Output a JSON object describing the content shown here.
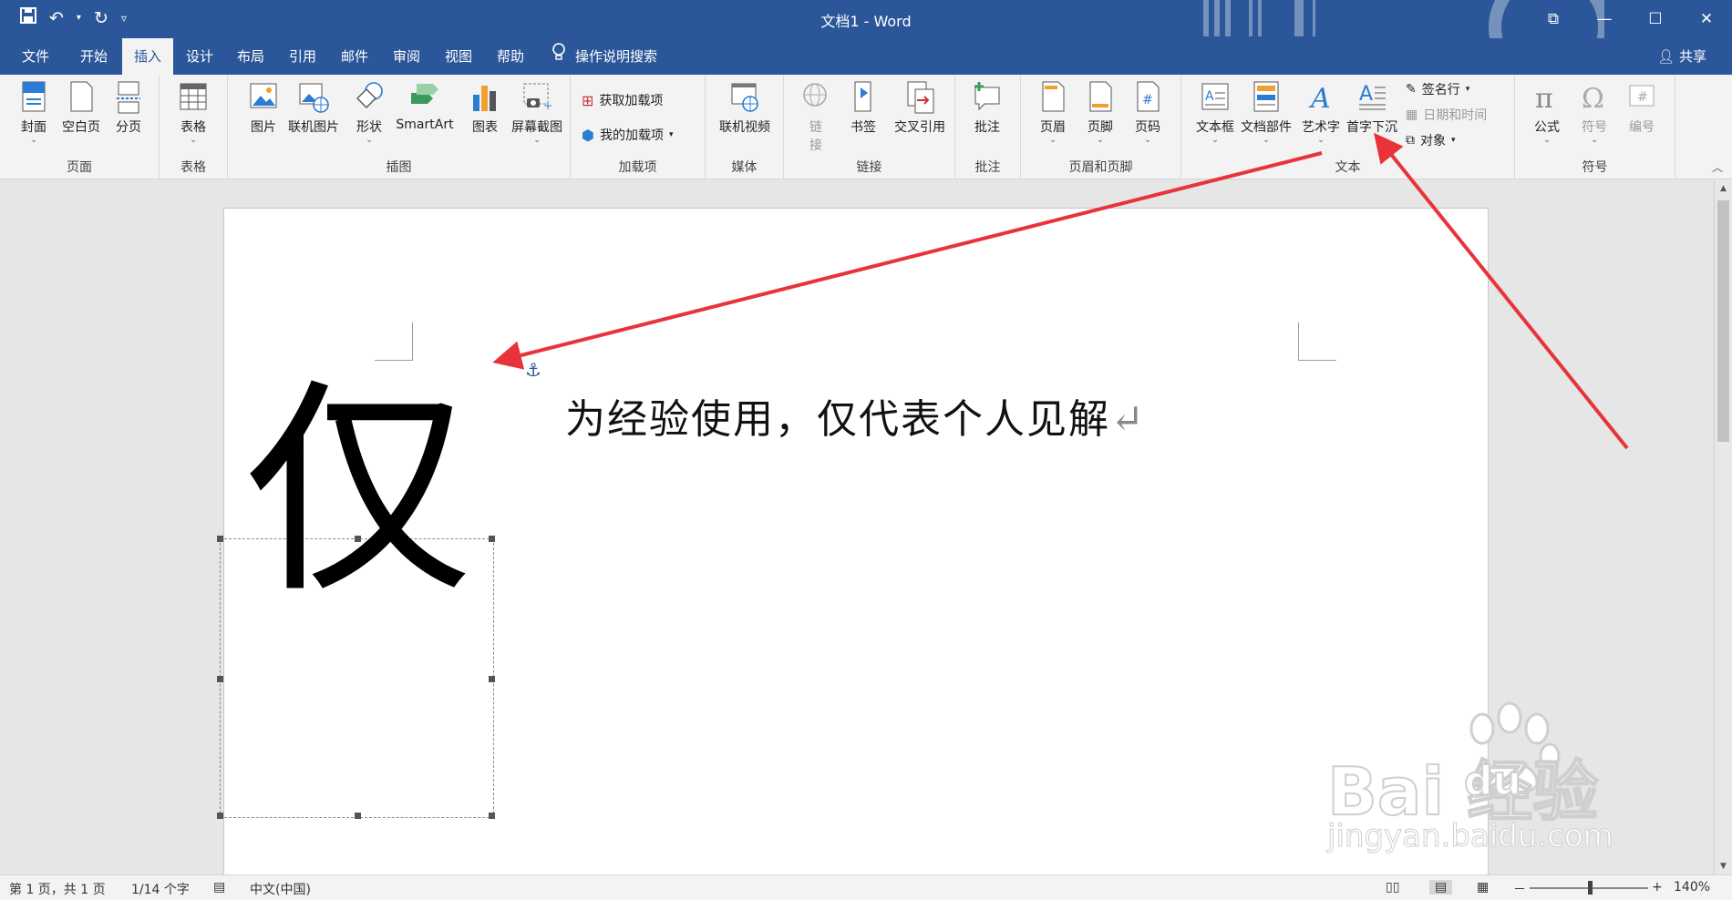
{
  "titlebar": {
    "title": "文档1 - Word",
    "qat": {
      "save_icon": "save-icon",
      "undo_icon": "undo-icon",
      "redo_icon": "redo-icon",
      "customize_icon": "qat-dropdown-icon"
    },
    "controls": {
      "ribbon_display": "⧉",
      "minimize": "—",
      "maximize": "☐",
      "close": "✕"
    }
  },
  "tabs": {
    "items": [
      {
        "label": "文件"
      },
      {
        "label": "开始"
      },
      {
        "label": "插入"
      },
      {
        "label": "设计"
      },
      {
        "label": "布局"
      },
      {
        "label": "引用"
      },
      {
        "label": "邮件"
      },
      {
        "label": "审阅"
      },
      {
        "label": "视图"
      },
      {
        "label": "帮助"
      }
    ],
    "active": "插入",
    "tell_me": "操作说明搜索",
    "share": "共享"
  },
  "ribbon": {
    "groups": {
      "pages": {
        "label": "页面",
        "buttons": [
          "封面",
          "空白页",
          "分页"
        ]
      },
      "tables": {
        "label": "表格",
        "buttons": [
          "表格"
        ]
      },
      "illustrations": {
        "label": "插图",
        "buttons": [
          "图片",
          "联机图片",
          "形状",
          "SmartArt",
          "图表",
          "屏幕截图"
        ]
      },
      "addins": {
        "label": "加载项",
        "buttons": [
          "获取加载项",
          "我的加载项"
        ]
      },
      "media": {
        "label": "媒体",
        "buttons": [
          "联机视频"
        ]
      },
      "links": {
        "label": "链接",
        "buttons": [
          "链接",
          "书签",
          "交叉引用"
        ],
        "link_line1": "链",
        "link_line2": "接"
      },
      "comments": {
        "label": "批注",
        "buttons": [
          "批注"
        ]
      },
      "header_footer": {
        "label": "页眉和页脚",
        "buttons": [
          "页眉",
          "页脚",
          "页码"
        ]
      },
      "text": {
        "label": "文本",
        "buttons": [
          "文本框",
          "文档部件",
          "艺术字",
          "首字下沉"
        ],
        "small": [
          "签名行",
          "日期和时间",
          "对象"
        ]
      },
      "symbols": {
        "label": "符号",
        "buttons": [
          "公式",
          "符号",
          "编号"
        ]
      }
    }
  },
  "document": {
    "dropcap": "仅",
    "body_text": "为经验使用，仅代表个人见解",
    "paragraph_mark": "↵"
  },
  "statusbar": {
    "page": "第 1 页，共 1 页",
    "words": "1/14 个字",
    "language": "中文(中国)",
    "zoom_minus": "－",
    "zoom_plus": "+",
    "zoom": "140%",
    "zoom_level_percent": 140
  },
  "watermark": {
    "main": "Bai 经验",
    "du": "du",
    "sub": "jingyan.baidu.com"
  },
  "colors": {
    "accent": "#2b579a",
    "arrow": "#e8333a",
    "ribbon_bg": "#f3f3f3"
  }
}
